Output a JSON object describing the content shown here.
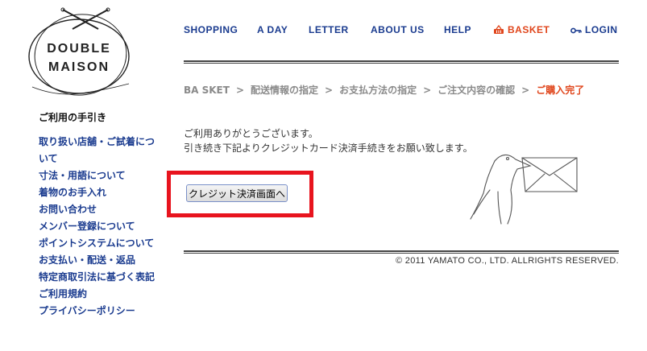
{
  "logo": {
    "line1": "DOUBLE",
    "line2": "MAISON"
  },
  "sidebar": {
    "title": "ご利用の手引き",
    "items": [
      {
        "label": "取り扱い店舗・ご試着について"
      },
      {
        "label": "寸法・用語について"
      },
      {
        "label": "着物のお手入れ"
      },
      {
        "label": "お問い合わせ"
      },
      {
        "label": "メンバー登録について"
      },
      {
        "label": "ポイントシステムについて"
      },
      {
        "label": "お支払い・配送・返品"
      },
      {
        "label": "特定商取引法に基づく表記"
      },
      {
        "label": "ご利用規約"
      },
      {
        "label": "プライバシーポリシー"
      }
    ]
  },
  "nav": {
    "shopping": "SHOPPING",
    "aday": "A DAY",
    "letter": "LETTER",
    "about": "ABOUT US",
    "help": "HELP",
    "basket": "BASKET",
    "login": "LOGIN"
  },
  "breadcrumb": {
    "basket": "BA SKET",
    "shipping": "配送情報の指定",
    "payment": "お支払方法の指定",
    "confirm": "ご注文内容の確認",
    "complete": "ご購入完了",
    "separator": ">"
  },
  "message": {
    "line1": "ご利用ありがとうございます。",
    "line2": "引き続き下記よりクレジットカード決済手続きをお願い致します。"
  },
  "credit_button": "クレジット決済画面へ",
  "footer": {
    "copyright": "© 2011 YAMATO CO., LTD. ALLRIGHTS RESERVED."
  },
  "colors": {
    "nav_blue": "#1a3b8f",
    "accent_orange": "#e0461c",
    "highlight_red": "#e8141e"
  },
  "icons": {
    "basket": "basket-icon",
    "login": "key-icon",
    "illustration": "bird-with-letter-illustration"
  }
}
